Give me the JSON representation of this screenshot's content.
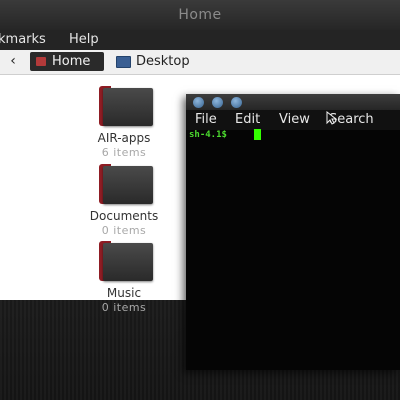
{
  "file_manager": {
    "title": "Home",
    "menu": [
      "kmarks",
      "Help"
    ],
    "pathbar": {
      "back_icon": "chevron-left-icon",
      "crumbs": [
        "Home",
        "Desktop"
      ]
    },
    "folders": [
      {
        "name": "AIR-apps",
        "count": "6 items"
      },
      {
        "name": "Documents",
        "count": "0 items"
      },
      {
        "name": "Music",
        "count": "0 items"
      }
    ]
  },
  "terminal": {
    "menu": [
      "File",
      "Edit",
      "View",
      "Search"
    ],
    "prompt": "sh-4.1$"
  },
  "colors": {
    "folder_accent": "#8f1d24",
    "prompt_green": "#4cdb2f",
    "cursor_green": "#33ff00"
  }
}
